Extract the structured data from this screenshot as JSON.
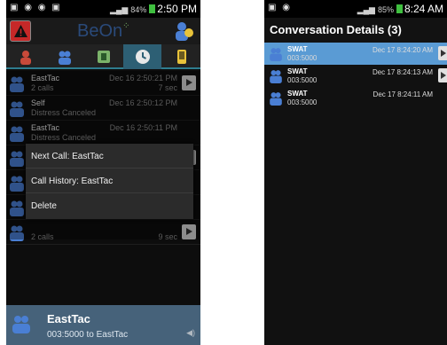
{
  "left": {
    "status": {
      "icons_left": "▣ ◉ ◉ ▣",
      "signal": "84%",
      "time": "2:50 PM"
    },
    "app_logo": "BeOn",
    "tabs": [
      "contacts",
      "groups",
      "map",
      "history",
      "settings"
    ],
    "history": [
      {
        "name": "EastTac",
        "sub": "2 calls",
        "time": "Dec 16 2:50:21 PM",
        "dur": "7 sec",
        "play": true
      },
      {
        "name": "Self",
        "sub": "Distress Canceled",
        "time": "Dec 16 2:50:12 PM",
        "dur": "",
        "play": false
      },
      {
        "name": "EastTac",
        "sub": "Distress Canceled",
        "time": "Dec 16 2:50:11 PM",
        "dur": "",
        "play": false
      },
      {
        "name": "",
        "sub": "",
        "time": "",
        "dur": "",
        "play": true
      },
      {
        "name": "",
        "sub": "",
        "time": "",
        "dur": "",
        "play": false
      },
      {
        "name": "",
        "sub": "",
        "time": "",
        "dur": "",
        "play": false
      },
      {
        "name": "",
        "sub": "2 calls",
        "time": "",
        "dur": "9 sec",
        "play": true
      }
    ],
    "context_menu": [
      "Next Call: EastTac",
      "Call History: EastTac",
      "Delete"
    ],
    "bottom": {
      "name": "EastTac",
      "sub": "003:5000 to EastTac"
    }
  },
  "right": {
    "status": {
      "icons_left": "▣ ◉",
      "signal": "85%",
      "time": "8:24 AM"
    },
    "title": "Conversation Details (3)",
    "rows": [
      {
        "name": "SWAT",
        "sub": "003:5000",
        "time": "Dec 17 8:24:20 AM",
        "selected": true,
        "play": true
      },
      {
        "name": "SWAT",
        "sub": "003:5000",
        "time": "Dec 17 8:24:13 AM",
        "selected": false,
        "play": true
      },
      {
        "name": "SWAT",
        "sub": "003:5000",
        "time": "Dec 17 8:24:11 AM",
        "selected": false,
        "play": false
      }
    ]
  }
}
